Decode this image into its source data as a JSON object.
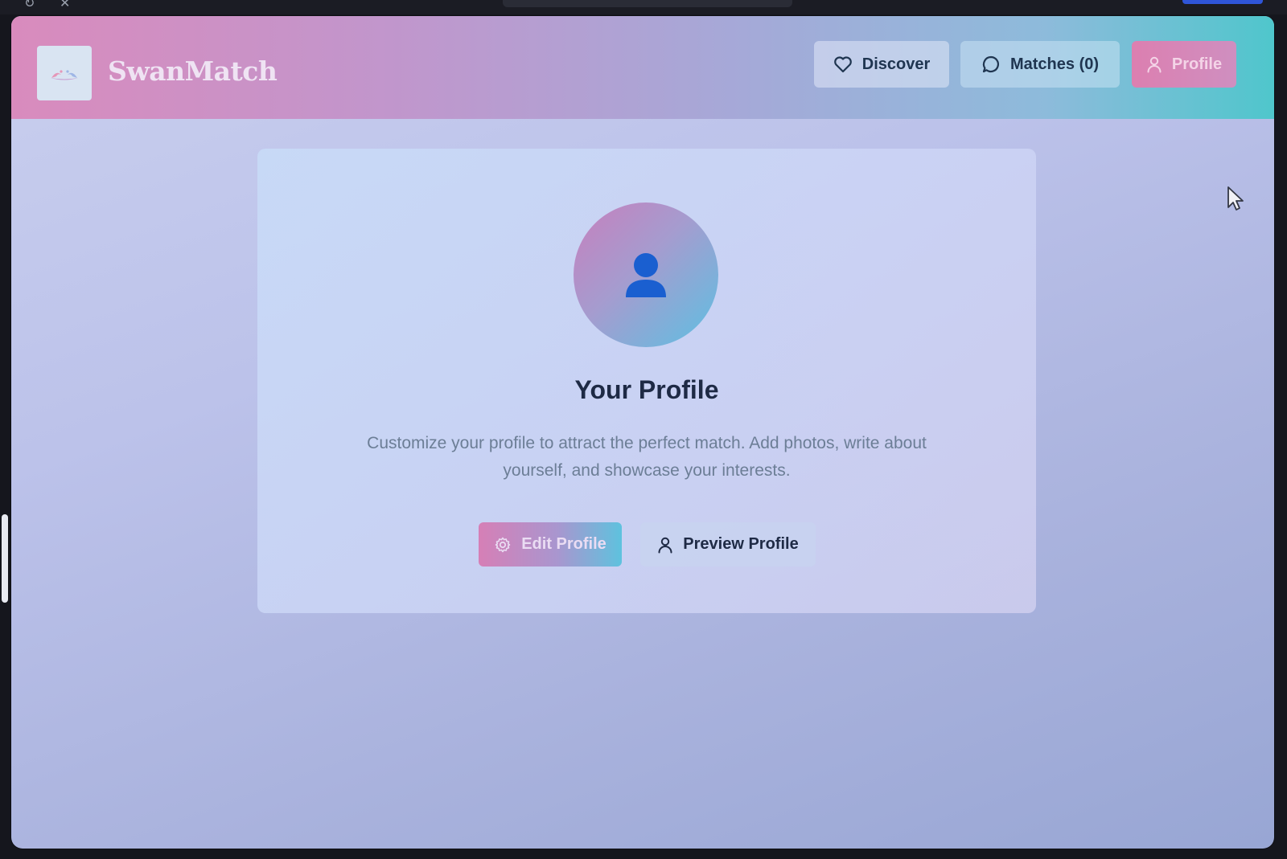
{
  "brand": {
    "name": "SwanMatch",
    "logo_icon": "swans-logo"
  },
  "nav": {
    "discover_label": "Discover",
    "matches_label": "Matches (0)",
    "profile_label": "Profile",
    "active_item": "profile"
  },
  "profile_card": {
    "avatar_icon": "user-silhouette",
    "title": "Your Profile",
    "description": "Customize your profile to attract the perfect match. Add photos, write about yourself, and showcase your interests.",
    "edit_label": "Edit Profile",
    "preview_label": "Preview Profile"
  },
  "colors": {
    "brand_pink": "#d98bbd",
    "brand_teal": "#4fc6cc",
    "heading_navy": "#1e2a45",
    "body_gray": "#6c7e96"
  }
}
